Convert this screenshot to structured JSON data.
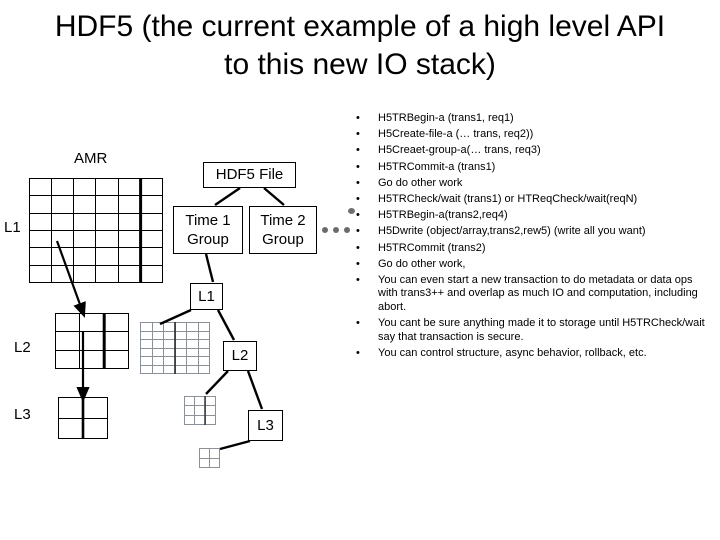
{
  "slide": {
    "title": "HDF5 (the current example of a high level API to this new IO stack)"
  },
  "diagram": {
    "amr_caption": "AMR",
    "level_labels": [
      {
        "name": "L1",
        "text": "L1"
      },
      {
        "name": "L2",
        "text": "L2"
      },
      {
        "name": "L3",
        "text": "L3"
      }
    ],
    "tree": {
      "root": "HDF5 File",
      "time_groups": [
        {
          "line1": "Time 1",
          "line2": "Group"
        },
        {
          "line1": "Time 2",
          "line2": "Group"
        }
      ],
      "ellipsis": "...",
      "levels": [
        {
          "label": "L1"
        },
        {
          "label": "L2"
        },
        {
          "label": "L3"
        }
      ]
    },
    "grids": {
      "amr_l1": {
        "cols": 6,
        "rows": 6
      },
      "amr_l2": {
        "cols": 3,
        "rows": 3
      },
      "amr_l3": {
        "cols": 2,
        "rows": 2
      },
      "tree_l1": {
        "cols": 6,
        "rows": 6
      },
      "tree_l2": {
        "cols": 3,
        "rows": 3
      },
      "tree_l3": {
        "cols": 2,
        "rows": 2
      }
    }
  },
  "bullets": {
    "marker": "•",
    "items": [
      "H5TRBegin-a (trans1, req1)",
      "H5Create-file-a (…  trans, req2))",
      "H5Creaet-group-a(… trans, req3)",
      "H5TRCommit-a (trans1)",
      "Go do other work",
      "H5TRCheck/wait (trans1) or HTReqCheck/wait(reqN)",
      "H5TRBegin-a(trans2,req4)",
      "H5Dwrite (object/array,trans2,rew5) (write all you want)",
      "H5TRCommit (trans2)",
      "Go do other work,",
      "You can even start a new transaction to do metadata or data ops with trans3++ and overlap as much IO and computation, including abort.",
      "You cant be sure anything made it to storage until H5TRCheck/wait say that transaction is secure.",
      "You can control structure, async behavior, rollback, etc."
    ]
  }
}
